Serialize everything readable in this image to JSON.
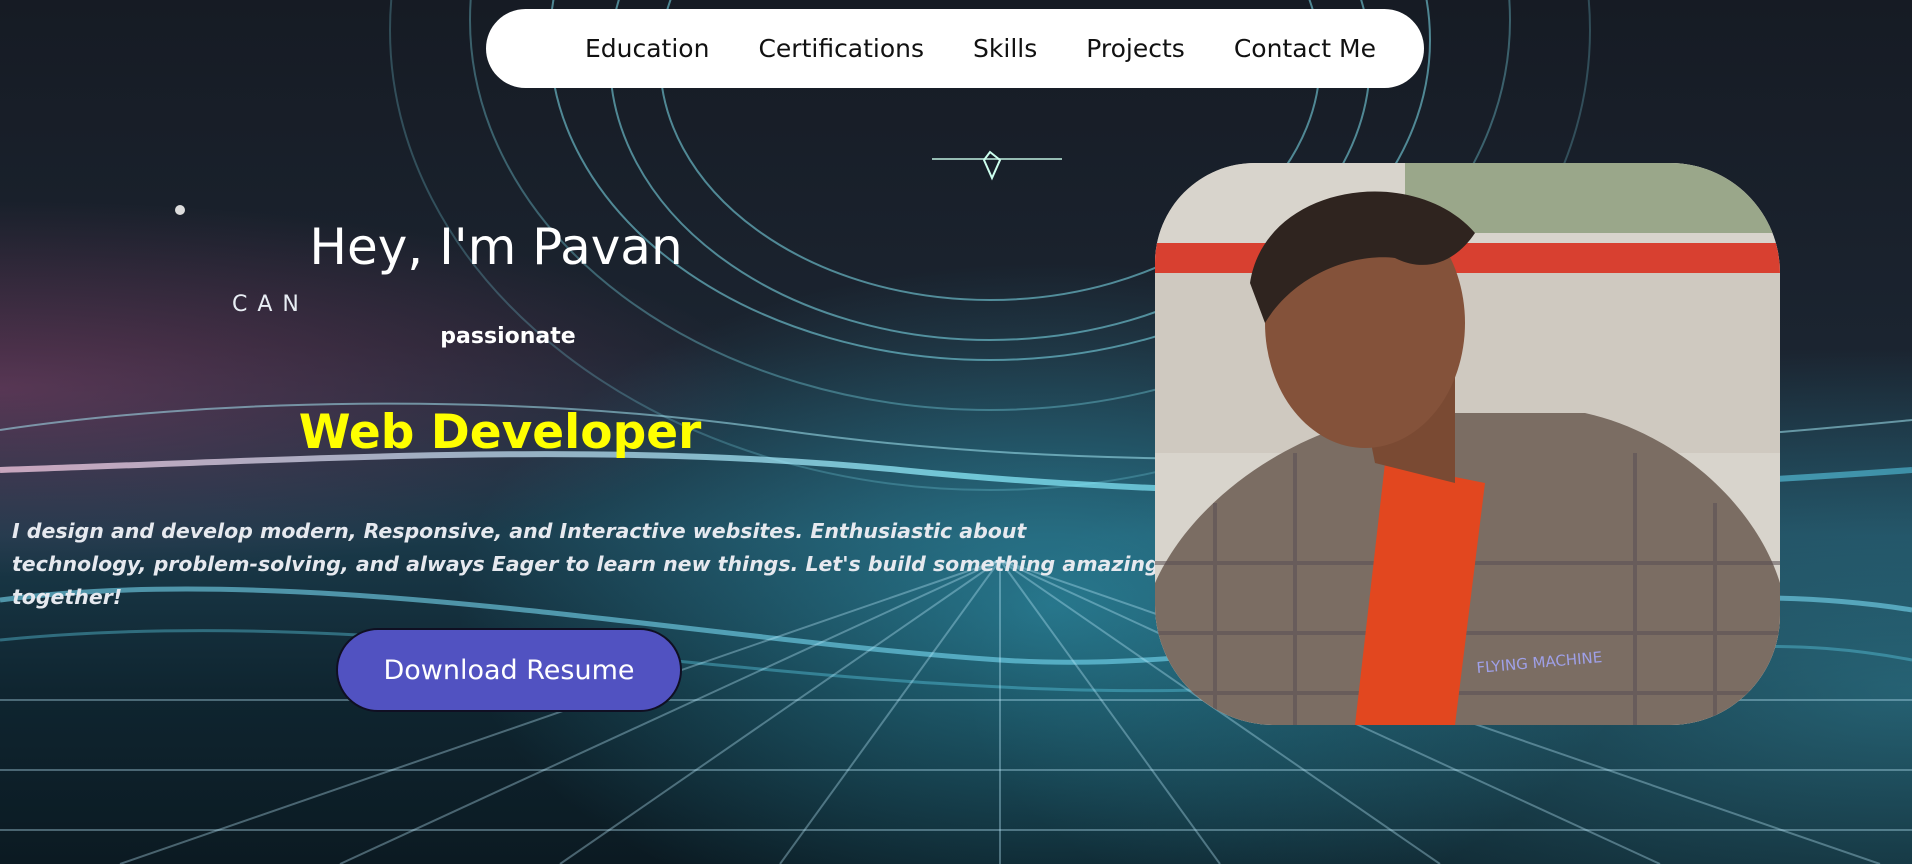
{
  "nav": {
    "items": [
      "Education",
      "Certifications",
      "Skills",
      "Projects",
      "Contact Me"
    ]
  },
  "hero": {
    "greeting": "Hey, I'm Pavan",
    "background_text": "CAN",
    "tagline": "passionate",
    "role": "Web Developer",
    "bio": "I design and develop modern, Responsive, and Interactive websites. Enthusiastic about technology, problem-solving, and always Eager to learn new things. Let's build something amazing together!",
    "download_label": "Download Resume",
    "shirt_label": "FLYING MACHINE"
  },
  "colors": {
    "role": "#ffff00",
    "button": "#5152c1",
    "nav_bg": "#ffffff"
  },
  "icons": {
    "profile_photo": "portrait-photo"
  }
}
